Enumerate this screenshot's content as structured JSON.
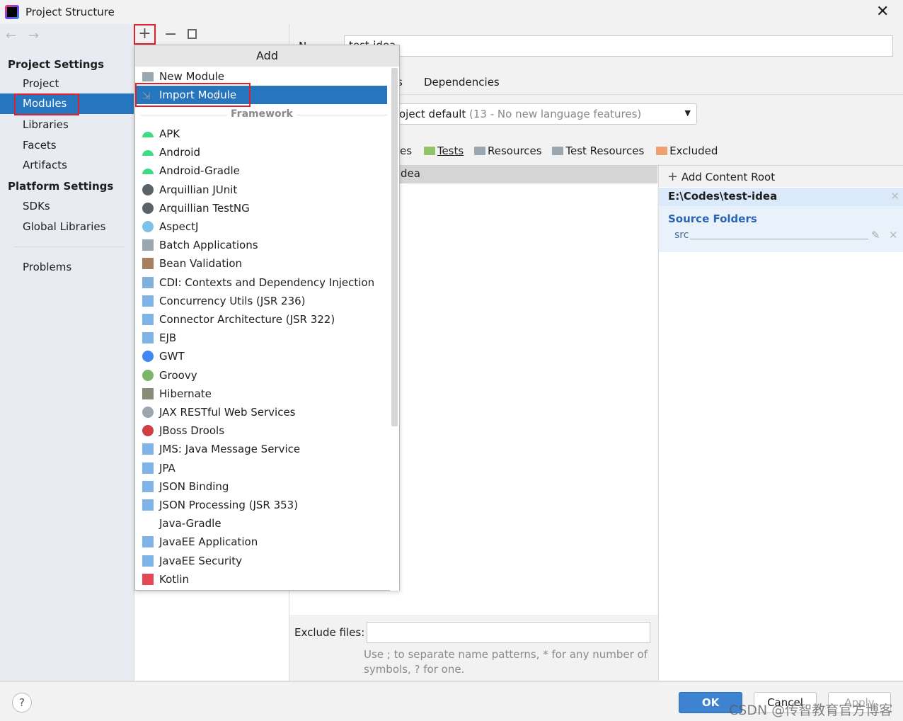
{
  "window": {
    "title": "Project Structure"
  },
  "sidebar": {
    "sections": [
      {
        "header": "Project Settings",
        "items": [
          "Project",
          "Modules",
          "Libraries",
          "Facets",
          "Artifacts"
        ]
      },
      {
        "header": "Platform Settings",
        "items": [
          "SDKs",
          "Global Libraries"
        ]
      }
    ],
    "problems": "Problems",
    "selected": "Modules"
  },
  "popup": {
    "title": "Add",
    "items": [
      {
        "label": "New Module",
        "icon": "folder-icon",
        "color": "#9aa7b0"
      },
      {
        "label": "Import Module",
        "icon": "import-icon",
        "color": "#9aa7b0",
        "selected": true
      }
    ],
    "separator": "Framework",
    "frameworks": [
      {
        "label": "APK",
        "icon": "android-icon",
        "color": "#3ddc84"
      },
      {
        "label": "Android",
        "icon": "android-icon",
        "color": "#3ddc84"
      },
      {
        "label": "Android-Gradle",
        "icon": "android-icon",
        "color": "#3ddc84"
      },
      {
        "label": "Arquillian JUnit",
        "icon": "arquillian-icon",
        "color": "#5a6468"
      },
      {
        "label": "Arquillian TestNG",
        "icon": "arquillian-icon",
        "color": "#5a6468"
      },
      {
        "label": "AspectJ",
        "icon": "aspectj-icon",
        "color": "#7fc1ea"
      },
      {
        "label": "Batch Applications",
        "icon": "batch-icon",
        "color": "#9aa7b0"
      },
      {
        "label": "Bean Validation",
        "icon": "bean-validation-icon",
        "color": "#a6805c"
      },
      {
        "label": "CDI: Contexts and Dependency Injection",
        "icon": "cdi-icon",
        "color": "#7fb0e0"
      },
      {
        "label": "Concurrency Utils (JSR 236)",
        "icon": "javaee-icon",
        "color": "#7fb4e8"
      },
      {
        "label": "Connector Architecture (JSR 322)",
        "icon": "javaee-icon",
        "color": "#7fb4e8"
      },
      {
        "label": "EJB",
        "icon": "javaee-icon",
        "color": "#7fb4e8"
      },
      {
        "label": "GWT",
        "icon": "google-icon",
        "color": "#4285f4"
      },
      {
        "label": "Groovy",
        "icon": "groovy-icon",
        "color": "#7cb46a"
      },
      {
        "label": "Hibernate",
        "icon": "hibernate-icon",
        "color": "#8a8a7a"
      },
      {
        "label": "JAX RESTful Web Services",
        "icon": "globe-icon",
        "color": "#9aa7b0"
      },
      {
        "label": "JBoss Drools",
        "icon": "drools-icon",
        "color": "#d04040"
      },
      {
        "label": "JMS: Java Message Service",
        "icon": "javaee-icon",
        "color": "#7fb4e8"
      },
      {
        "label": "JPA",
        "icon": "jpa-icon",
        "color": "#7fb4e8"
      },
      {
        "label": "JSON Binding",
        "icon": "javaee-icon",
        "color": "#7fb4e8"
      },
      {
        "label": "JSON Processing (JSR 353)",
        "icon": "javaee-icon",
        "color": "#7fb4e8"
      },
      {
        "label": "Java-Gradle",
        "icon": "none",
        "color": ""
      },
      {
        "label": "JavaEE Application",
        "icon": "javaee-app-icon",
        "color": "#7fb4e8"
      },
      {
        "label": "JavaEE Security",
        "icon": "javaee-icon",
        "color": "#7fb4e8"
      },
      {
        "label": "Kotlin",
        "icon": "kotlin-icon",
        "color": "#e44857"
      }
    ]
  },
  "main": {
    "name_label": "N",
    "name_value": "test-idea",
    "tab_partial": "s",
    "tab_dependencies": "Dependencies",
    "language_level": "oject default",
    "language_level_hint": "(13 - No new language features)",
    "mark_as": [
      {
        "label": "es",
        "color": ""
      },
      {
        "label": "Tests",
        "color": "#8fc46a"
      },
      {
        "label": "Resources",
        "color": "#9aa7b0"
      },
      {
        "label": "Test Resources",
        "color": "#9aa7b0"
      },
      {
        "label": "Excluded",
        "color": "#f0a070"
      }
    ],
    "tree_row": "dea",
    "add_content_root": "Add Content Root",
    "content_root": "E:\\Codes\\test-idea",
    "source_folders": "Source Folders",
    "source_folder": "src",
    "exclude_label": "Exclude files:",
    "exclude_value": "",
    "help_line1": "Use ; to separate name patterns, * for any number of",
    "help_line2": "symbols, ? for one."
  },
  "footer": {
    "help": "?",
    "ok": "OK",
    "cancel": "Cancel",
    "apply": "Apply",
    "watermark": "CSDN @传智教育官方博客"
  },
  "colors": {
    "accent": "#2675bf",
    "highlight": "#e0202a",
    "ok": "#3d83d0"
  }
}
